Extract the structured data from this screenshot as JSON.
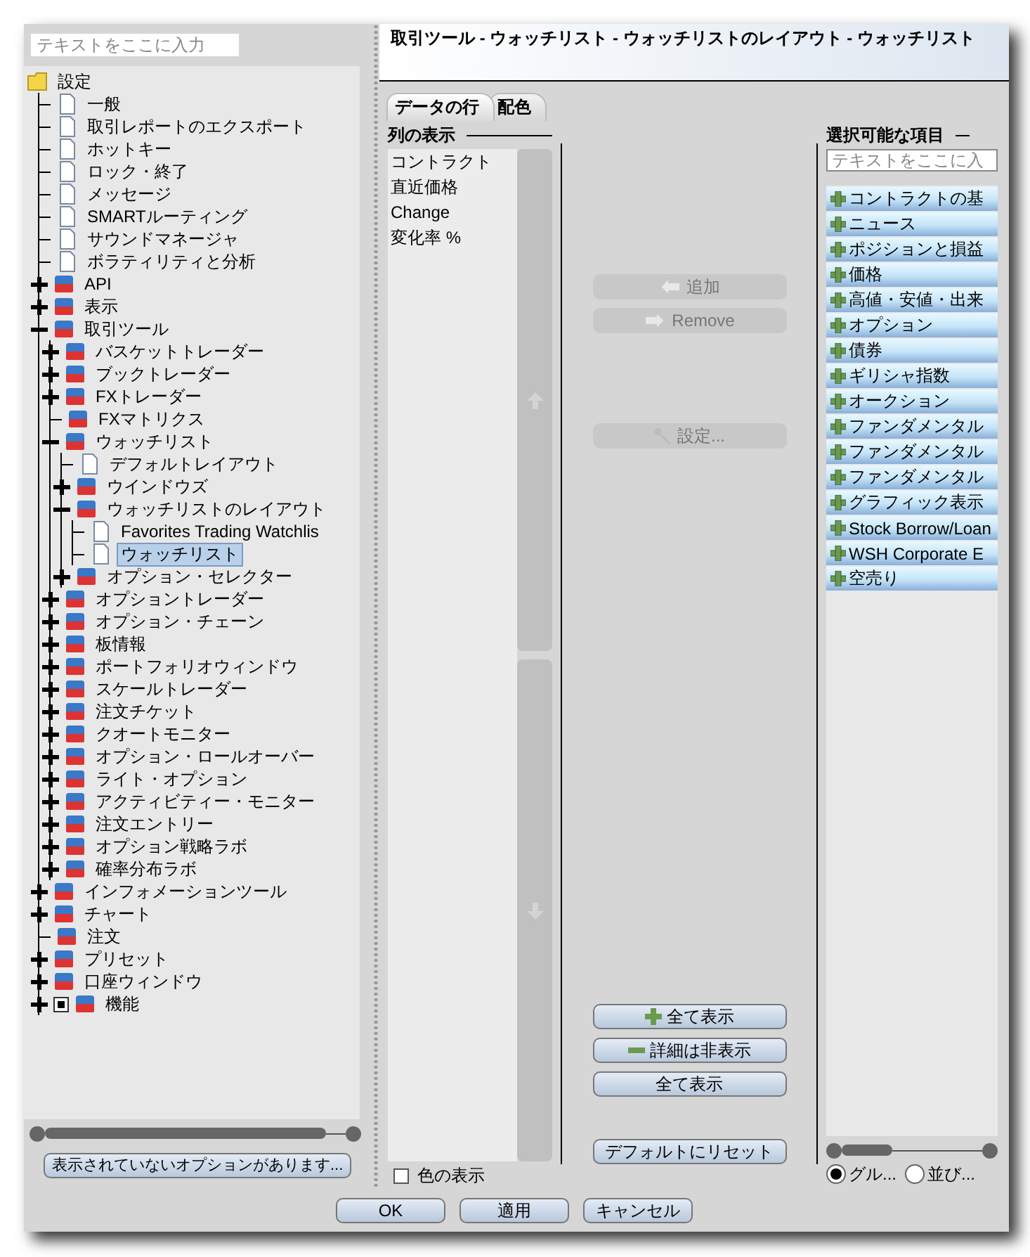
{
  "tree_panel": {
    "search": {
      "placeholder": "テキストをここに入力"
    },
    "tree": [
      {
        "label": "設定",
        "kind": "folder",
        "selected": false,
        "children": [
          {
            "label": "一般",
            "kind": "page",
            "selected": false
          },
          {
            "label": "取引レポートのエクスポート",
            "kind": "page",
            "selected": false
          },
          {
            "label": "ホットキー",
            "kind": "page",
            "selected": false
          },
          {
            "label": "ロック・終了",
            "kind": "page",
            "selected": false
          },
          {
            "label": "メッセージ",
            "kind": "page",
            "selected": false
          },
          {
            "label": "SMARTルーティング",
            "kind": "page",
            "selected": false
          },
          {
            "label": "サウンドマネージャ",
            "kind": "page",
            "selected": false
          },
          {
            "label": "ボラティリティと分析",
            "kind": "page",
            "selected": false
          },
          {
            "label": "API",
            "kind": "tool",
            "expanded": false,
            "selected": false
          },
          {
            "label": "表示",
            "kind": "tool",
            "expanded": false,
            "selected": false
          },
          {
            "label": "取引ツール",
            "kind": "tool",
            "expanded": true,
            "selected": false,
            "children": [
              {
                "label": "バスケットトレーダー",
                "kind": "tool",
                "expanded": false,
                "selected": false
              },
              {
                "label": "ブックトレーダー",
                "kind": "tool",
                "expanded": false,
                "selected": false
              },
              {
                "label": "FXトレーダー",
                "kind": "tool",
                "expanded": false,
                "selected": false
              },
              {
                "label": "FXマトリクス",
                "kind": "tool",
                "selected": false
              },
              {
                "label": "ウォッチリスト",
                "kind": "tool",
                "expanded": true,
                "selected": false,
                "children": [
                  {
                    "label": "デフォルトレイアウト",
                    "kind": "page",
                    "selected": false
                  },
                  {
                    "label": "ウインドウズ",
                    "kind": "tool",
                    "expanded": false,
                    "selected": false
                  },
                  {
                    "label": "ウォッチリストのレイアウト",
                    "kind": "tool",
                    "expanded": true,
                    "selected": false,
                    "children": [
                      {
                        "label": "Favorites Trading Watchlis",
                        "kind": "page",
                        "selected": false
                      },
                      {
                        "label": "ウォッチリスト",
                        "kind": "page",
                        "selected": true
                      }
                    ]
                  },
                  {
                    "label": "オプション・セレクター",
                    "kind": "tool",
                    "expanded": false,
                    "selected": false
                  }
                ]
              },
              {
                "label": "オプショントレーダー",
                "kind": "tool",
                "expanded": false,
                "selected": false
              },
              {
                "label": "オプション・チェーン",
                "kind": "tool",
                "expanded": false,
                "selected": false
              },
              {
                "label": "板情報",
                "kind": "tool",
                "expanded": false,
                "selected": false
              },
              {
                "label": "ポートフォリオウィンドウ",
                "kind": "tool",
                "expanded": false,
                "selected": false
              },
              {
                "label": "スケールトレーダー",
                "kind": "tool",
                "expanded": false,
                "selected": false
              },
              {
                "label": "注文チケット",
                "kind": "tool",
                "expanded": false,
                "selected": false
              },
              {
                "label": "クオートモニター",
                "kind": "tool",
                "expanded": false,
                "selected": false
              },
              {
                "label": "オプション・ロールオーバー",
                "kind": "tool",
                "expanded": false,
                "selected": false
              },
              {
                "label": "ライト・オプション",
                "kind": "tool",
                "expanded": false,
                "selected": false
              },
              {
                "label": "アクティビティー・モニター",
                "kind": "tool",
                "expanded": false,
                "selected": false
              },
              {
                "label": "注文エントリー",
                "kind": "tool",
                "expanded": false,
                "selected": false
              },
              {
                "label": "オプション戦略ラボ",
                "kind": "tool",
                "expanded": false,
                "selected": false
              },
              {
                "label": "確率分布ラボ",
                "kind": "tool",
                "expanded": false,
                "selected": false
              }
            ]
          },
          {
            "label": "インフォメーションツール",
            "kind": "tool",
            "expanded": false,
            "selected": false
          },
          {
            "label": "チャート",
            "kind": "tool",
            "expanded": false,
            "selected": false
          },
          {
            "label": "注文",
            "kind": "tool",
            "selected": false
          },
          {
            "label": "プリセット",
            "kind": "tool",
            "expanded": false,
            "selected": false
          },
          {
            "label": "口座ウィンドウ",
            "kind": "tool",
            "expanded": false,
            "selected": false
          },
          {
            "label": "機能",
            "kind": "tool",
            "expanded": false,
            "checked": true,
            "selected": false
          }
        ]
      }
    ],
    "hidden_options_button": "表示されていないオプションがあります..."
  },
  "page": {
    "title": "取引ツール - ウォッチリスト - ウォッチリストのレイアウト - ウォッチリスト",
    "tabs": [
      {
        "label": "データの行",
        "selected": true
      },
      {
        "label": "配色",
        "selected": false
      }
    ],
    "shown_columns": {
      "heading": "列の表示",
      "items": [
        "コントラクト",
        "直近価格",
        "Change",
        "変化率 %"
      ],
      "show_colors": {
        "label": "色の表示",
        "checked": false
      }
    },
    "top_buttons": [
      {
        "label": "追加",
        "kind": "add",
        "disabled": true
      },
      {
        "label": "Remove",
        "kind": "remove",
        "disabled": true
      },
      {
        "label": "設定...",
        "kind": "settings",
        "disabled": true
      }
    ],
    "bottom_buttons": [
      {
        "label": "全て表示",
        "kind": "expand",
        "disabled": false
      },
      {
        "label": "詳細は非表示",
        "kind": "collapse",
        "disabled": false
      },
      {
        "label": "全て表示",
        "kind": "plain",
        "disabled": false
      },
      {
        "label": "デフォルトにリセット",
        "kind": "reset",
        "disabled": false
      }
    ],
    "available": {
      "heading": "選択可能な項目",
      "search": {
        "placeholder": "テキストをここに入"
      },
      "items": [
        "コントラクトの基",
        "ニュース",
        "ポジションと損益",
        "価格",
        "高値・安値・出来",
        "オプション",
        "債券",
        "ギリシャ指数",
        "オークション",
        "ファンダメンタル",
        "ファンダメンタル",
        "ファンダメンタル",
        "グラフィック表示",
        "Stock Borrow/Loan",
        "WSH Corporate E",
        "空売り"
      ],
      "sort": [
        {
          "label": "グル...",
          "selected": true
        },
        {
          "label": "並び...",
          "selected": false
        }
      ]
    }
  },
  "buttons": [
    "OK",
    "適用",
    "キャンセル"
  ]
}
